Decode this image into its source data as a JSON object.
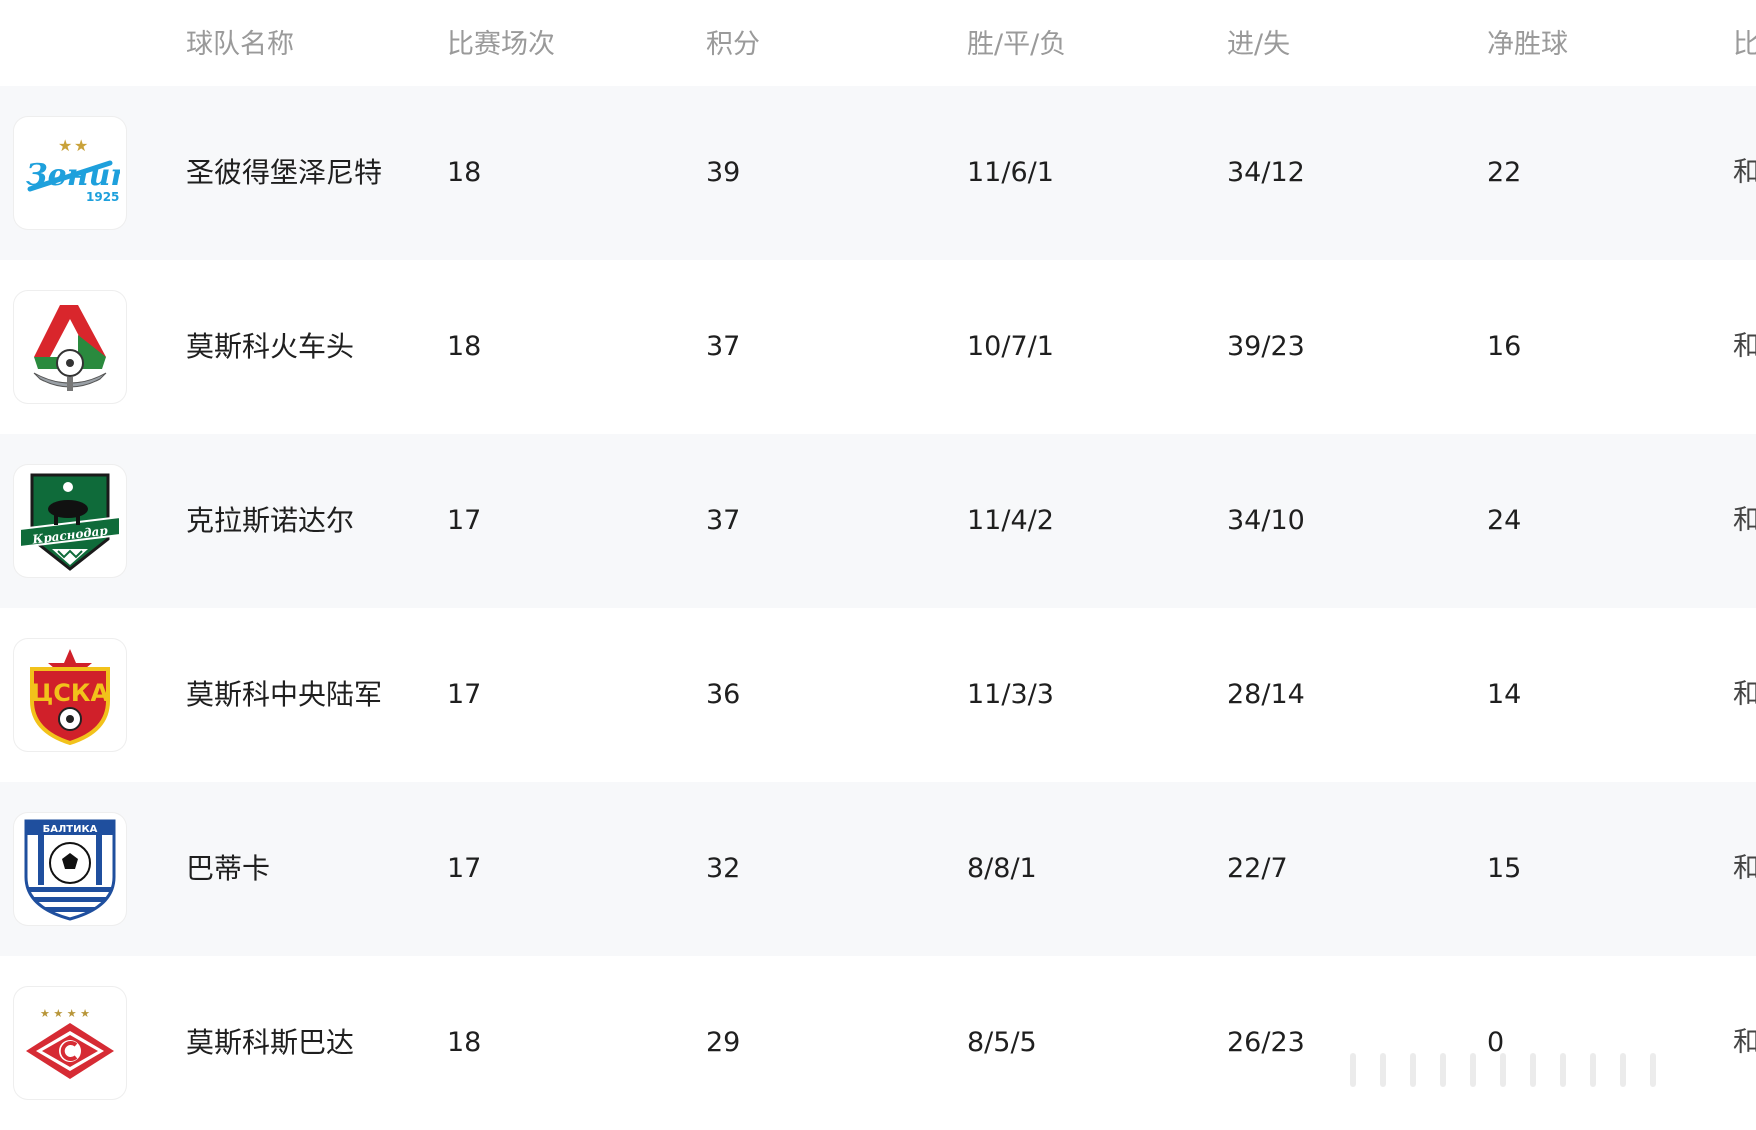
{
  "headers": {
    "team": "球队名称",
    "played": "比赛场次",
    "points": "积分",
    "wdl": "胜/平/负",
    "gfga": "进/失",
    "gd": "净胜球",
    "extra": "比"
  },
  "rows": [
    {
      "logo": "zenit-logo",
      "name": "圣彼得堡泽尼特",
      "played": "18",
      "points": "39",
      "wdl": "11/6/1",
      "gfga": "34/12",
      "gd": "22",
      "extra": "和"
    },
    {
      "logo": "lokomotiv-logo",
      "name": "莫斯科火车头",
      "played": "18",
      "points": "37",
      "wdl": "10/7/1",
      "gfga": "39/23",
      "gd": "16",
      "extra": "和"
    },
    {
      "logo": "krasnodar-logo",
      "name": "克拉斯诺达尔",
      "played": "17",
      "points": "37",
      "wdl": "11/4/2",
      "gfga": "34/10",
      "gd": "24",
      "extra": "和"
    },
    {
      "logo": "cska-logo",
      "name": "莫斯科中央陆军",
      "played": "17",
      "points": "36",
      "wdl": "11/3/3",
      "gfga": "28/14",
      "gd": "14",
      "extra": "和"
    },
    {
      "logo": "baltika-logo",
      "name": "巴蒂卡",
      "played": "17",
      "points": "32",
      "wdl": "8/8/1",
      "gfga": "22/7",
      "gd": "15",
      "extra": "和"
    },
    {
      "logo": "spartak-logo",
      "name": "莫斯科斯巴达",
      "played": "18",
      "points": "29",
      "wdl": "8/5/5",
      "gfga": "26/23",
      "gd": "0",
      "extra": "和"
    }
  ],
  "logo_text": {
    "zenit": "Зенит",
    "zenit_year": "1925",
    "krasnodar": "Краснодар",
    "cska": "ЦСКА",
    "baltika": "БАЛТИКА"
  },
  "colors": {
    "header_text": "#9a9a9a",
    "row_alt_bg": "#f7f8fa",
    "zenit_blue": "#1ea0dc",
    "lokomotiv_red": "#d9262c",
    "lokomotiv_green": "#2a8a3e",
    "krasnodar_green": "#0f6b3a",
    "cska_red": "#d0202a",
    "baltika_blue": "#1f4f9e",
    "spartak_red": "#d62b34"
  }
}
